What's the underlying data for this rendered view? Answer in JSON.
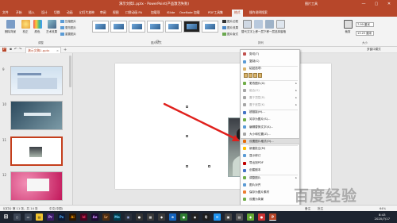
{
  "window": {
    "title": "演示文稿1.pptx - PowerPoint(产品激活失败)",
    "context_tab": "图片工具",
    "controls": [
      "—",
      "▢",
      "✕"
    ]
  },
  "tabs": [
    "文件",
    "开始",
    "插入",
    "设计",
    "切换",
    "动画",
    "幻灯片放映",
    "审阅",
    "视图",
    "口袋动画 PA",
    "加载项",
    "iSlide",
    "OneNote 加载",
    "PDF工具集",
    "格式",
    "操作说明搜索"
  ],
  "ribbon": {
    "adjust": {
      "remove_bg": "删除背景",
      "correct": "校正",
      "color": "颜色",
      "art": "艺术效果"
    },
    "adjust_small": [
      "压缩图片",
      "更改图片",
      "重置图片"
    ],
    "adjust_group": "调整",
    "styles_group": "图片样式",
    "right_small": [
      "图片边框",
      "图片效果",
      "图片版式"
    ],
    "arrange": {
      "alt_text": "替代文字",
      "bring_forward": "上移一层",
      "send_backward": "下移一层",
      "selection_pane": "选择窗格"
    },
    "arrange_group": "排列",
    "crop": "裁剪",
    "size": {
      "height": "7.99 厘米",
      "width": "13.23 厘米"
    },
    "size_group": "大小",
    "accessibility": "辅助功能"
  },
  "qat": {
    "doc_tab": "演示文稿1.pptx",
    "right_label": "多窗口模式"
  },
  "thumbnails": [
    {
      "number": "9"
    },
    {
      "number": "10"
    },
    {
      "number": "11"
    },
    {
      "number": "12"
    }
  ],
  "context_menu": {
    "items": [
      {
        "label": "剪切(T)",
        "disabled": false,
        "icon": "scissors-icon"
      },
      {
        "label": "复制(C)",
        "disabled": false,
        "icon": "copy-icon"
      },
      {
        "label": "粘贴选项:",
        "disabled": false,
        "icon": "paste-icon"
      },
      {
        "label": "",
        "disabled": false,
        "icon": "paste-options"
      },
      {
        "label": "更改图片(A)",
        "disabled": false,
        "icon": "change-picture-icon",
        "sub": true
      },
      {
        "label": "组合(G)",
        "disabled": true,
        "icon": "group-icon",
        "sub": true
      },
      {
        "label": "置于顶层(R)",
        "disabled": true,
        "icon": "bring-front-icon",
        "sub": true
      },
      {
        "label": "置于底层(K)",
        "disabled": true,
        "icon": "send-back-icon",
        "sub": true
      },
      {
        "label": "超链接(H)...",
        "disabled": false,
        "icon": "link-icon"
      },
      {
        "label": "另存为图片(S)...",
        "disabled": false,
        "icon": "save-picture-icon"
      },
      {
        "label": "编辑替换文字(A)...",
        "disabled": false,
        "icon": "alt-text-icon"
      },
      {
        "label": "大小和位置(Z)...",
        "disabled": false,
        "icon": "size-icon"
      },
      {
        "label": "设置图片格式(O)...",
        "disabled": false,
        "icon": "format-picture-icon",
        "highlighted": true
      },
      {
        "label": "新建批注(M)",
        "disabled": false,
        "icon": "comment-icon"
      },
      {
        "label": "显示修订",
        "disabled": false,
        "icon": "track-icon"
      },
      {
        "label": "导出到PDF",
        "disabled": false,
        "icon": "pdf-icon"
      },
      {
        "label": "创建副本",
        "disabled": false,
        "icon": "copy2-icon"
      },
      {
        "label": "调整图片",
        "disabled": false,
        "icon": "adjust-icon",
        "sub": true
      },
      {
        "label": "图片对齐",
        "disabled": false,
        "icon": "align-icon"
      },
      {
        "label": "保存为图片素材",
        "disabled": false,
        "icon": "asset-icon"
      },
      {
        "label": "设置为背景",
        "disabled": false,
        "icon": "background-icon"
      },
      {
        "label": "收藏图片",
        "disabled": false,
        "icon": "favorite-icon"
      }
    ]
  },
  "status": {
    "slide_info": "幻灯片 第 11 张，共 14 张",
    "language": "中文(中国)",
    "notes": "备注",
    "comments": "批注",
    "zoom": "64%"
  },
  "taskbar": {
    "time": "8:43",
    "date": "2020/7/17"
  },
  "watermark": "百度经验",
  "colors": {
    "accent": "#b7472a",
    "taskbar": "#1d2430",
    "highlight": "#dedede"
  }
}
